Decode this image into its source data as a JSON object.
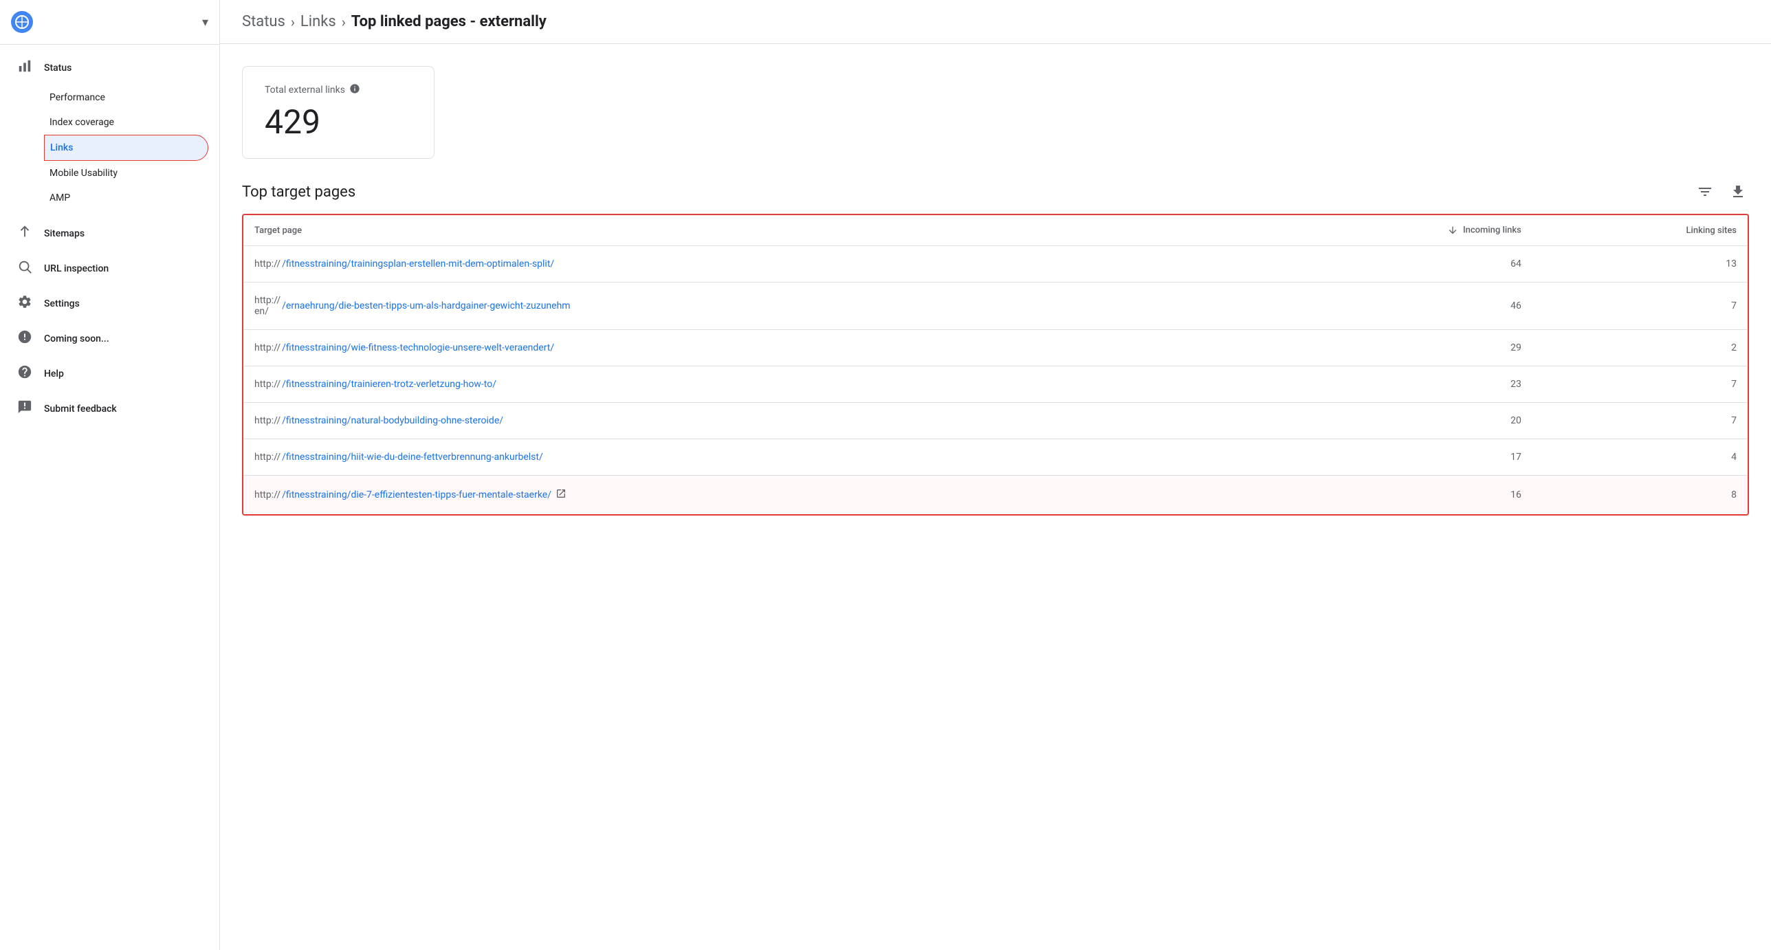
{
  "sidebar": {
    "logo_icon": "●",
    "dropdown_icon": "▾",
    "items": [
      {
        "id": "status",
        "label": "Status",
        "icon": "📊",
        "active": false,
        "sub_items": [
          {
            "id": "performance",
            "label": "Performance",
            "active": false
          },
          {
            "id": "index-coverage",
            "label": "Index coverage",
            "active": false
          },
          {
            "id": "links",
            "label": "Links",
            "active": true
          }
        ]
      },
      {
        "id": "sitemaps",
        "label": "Sitemaps",
        "icon": "↑",
        "active": false,
        "sub_items": []
      },
      {
        "id": "url-inspection",
        "label": "URL inspection",
        "icon": "🔍",
        "active": false,
        "sub_items": []
      },
      {
        "id": "settings",
        "label": "Settings",
        "icon": "⚙",
        "active": false,
        "sub_items": []
      },
      {
        "id": "coming-soon",
        "label": "Coming soon...",
        "icon": "ℹ",
        "active": false,
        "sub_items": []
      },
      {
        "id": "help",
        "label": "Help",
        "icon": "?",
        "active": false,
        "sub_items": []
      },
      {
        "id": "submit-feedback",
        "label": "Submit feedback",
        "icon": "!",
        "active": false,
        "sub_items": []
      }
    ]
  },
  "sub_items_mobile_usability": "Mobile Usability",
  "sub_items_amp": "AMP",
  "breadcrumb": {
    "items": [
      "Status",
      "Links"
    ],
    "current": "Top linked pages - externally"
  },
  "stat_card": {
    "label": "Total external links",
    "value": "429"
  },
  "section": {
    "title": "Top target pages"
  },
  "table": {
    "headers": {
      "target_page": "Target page",
      "incoming_links": "Incoming links",
      "linking_sites": "Linking sites"
    },
    "rows": [
      {
        "prefix": "http://",
        "path": "/fitnesstraining/trainingsplan-erstellen-mit-dem-optimalen-split/",
        "incoming_links": "64",
        "linking_sites": "13",
        "has_ext_link": false,
        "highlight": false
      },
      {
        "prefix": "http://\nen/",
        "path": "/ernaehrung/die-besten-tipps-um-als-hardgainer-gewicht-zuzunehm",
        "incoming_links": "46",
        "linking_sites": "7",
        "has_ext_link": false,
        "highlight": false
      },
      {
        "prefix": "http://",
        "path": "/fitnesstraining/wie-fitness-technologie-unsere-welt-veraendert/",
        "incoming_links": "29",
        "linking_sites": "2",
        "has_ext_link": false,
        "highlight": false
      },
      {
        "prefix": "http://",
        "path": "/fitnesstraining/trainieren-trotz-verletzung-how-to/",
        "incoming_links": "23",
        "linking_sites": "7",
        "has_ext_link": false,
        "highlight": false
      },
      {
        "prefix": "http://",
        "path": "/fitnesstraining/natural-bodybuilding-ohne-steroide/",
        "incoming_links": "20",
        "linking_sites": "7",
        "has_ext_link": false,
        "highlight": false
      },
      {
        "prefix": "http://",
        "path": "/fitnesstraining/hiit-wie-du-deine-fettverbrennung-ankurbelst/",
        "incoming_links": "17",
        "linking_sites": "4",
        "has_ext_link": false,
        "highlight": false
      },
      {
        "prefix": "http://",
        "path": "/fitnesstraining/die-7-effizientesten-tipps-fuer-mentale-staerke/",
        "incoming_links": "16",
        "linking_sites": "8",
        "has_ext_link": true,
        "highlight": true
      }
    ]
  }
}
